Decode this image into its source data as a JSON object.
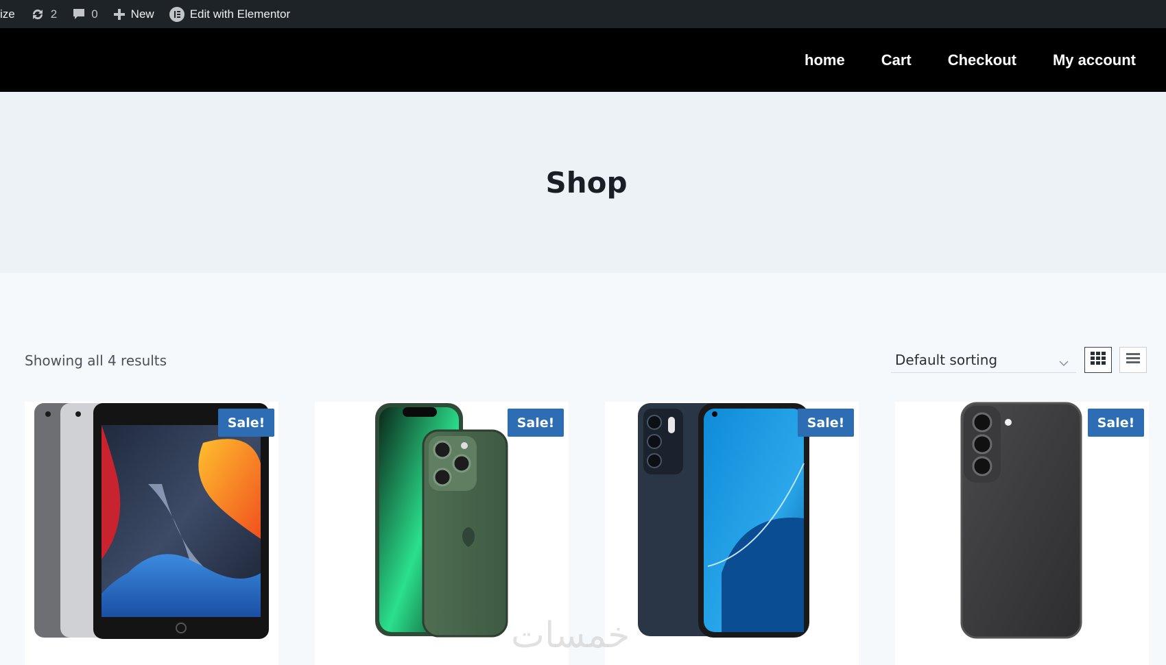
{
  "admin_bar": {
    "customize_fragment": "ize",
    "updates_count": "2",
    "comments_count": "0",
    "new_label": "New",
    "elementor_label": "Edit with Elementor"
  },
  "nav": {
    "links": [
      "home",
      "Cart",
      "Checkout",
      "My account"
    ]
  },
  "hero": {
    "title": "Shop"
  },
  "toolbar": {
    "result_count": "Showing all 4 results",
    "sorting_selected": "Default sorting"
  },
  "products": [
    {
      "badge": "Sale!",
      "image": "ipad-image"
    },
    {
      "badge": "Sale!",
      "image": "iphone-13-pro-green-image"
    },
    {
      "badge": "Sale!",
      "image": "oppo-reno-image"
    },
    {
      "badge": "Sale!",
      "image": "samsung-s21-fe-image"
    }
  ],
  "watermark": "خمسات",
  "colors": {
    "admin_bar_bg": "#1d2327",
    "nav_bg": "#000000",
    "hero_bg": "#edf2f6",
    "page_bg": "#f5f9fc",
    "sale_badge": "#2c6db4"
  }
}
